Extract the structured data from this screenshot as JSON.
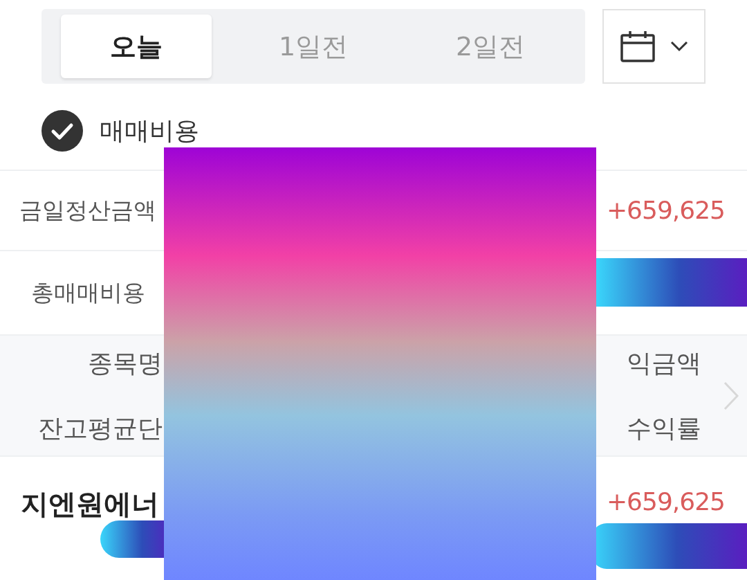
{
  "tabs": [
    {
      "label": "오늘",
      "selected": true
    },
    {
      "label": "1일전",
      "selected": false
    },
    {
      "label": "2일전",
      "selected": false
    }
  ],
  "date_picker": {
    "expanded": false
  },
  "option": {
    "label": "매매비용",
    "checked": true
  },
  "summary": [
    {
      "label": "금일정산금액",
      "value": "+659,625"
    },
    {
      "label": "총매매비용"
    }
  ],
  "holdings_header": {
    "left": [
      "종목명",
      "잔고평균단"
    ],
    "right": [
      "익금액",
      "수익률"
    ]
  },
  "holdings": [
    {
      "name": "지엔원에너",
      "profit": "+659,625"
    }
  ]
}
